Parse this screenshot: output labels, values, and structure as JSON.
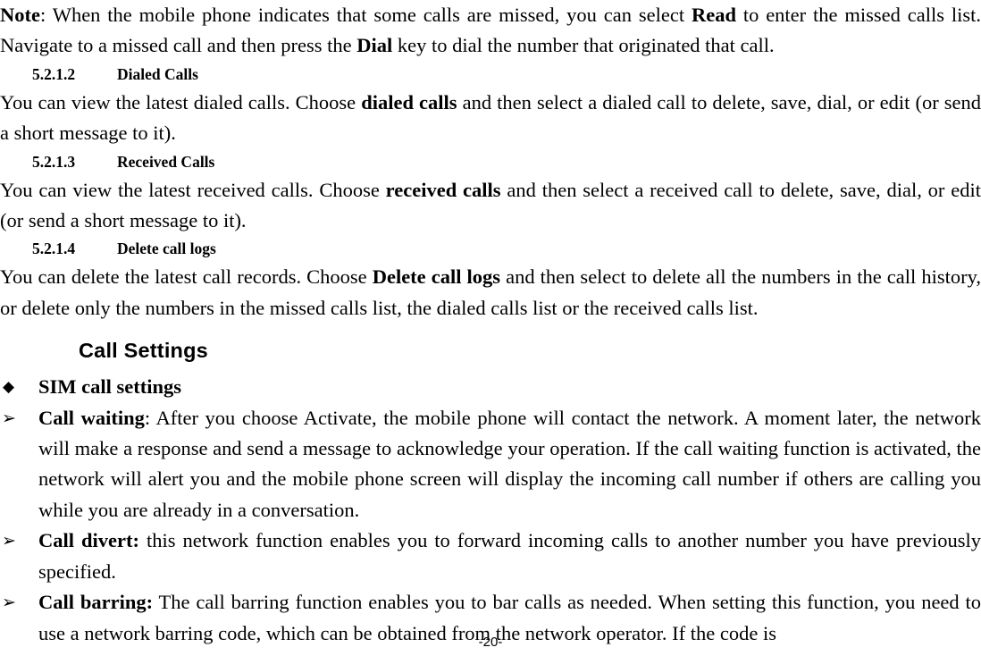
{
  "document": {
    "page_number_label": "-20-"
  },
  "blocks": {
    "note_paragraph": {
      "lead_bold": "Note",
      "text_part_1": ": When the mobile phone indicates that some calls are missed, you can select ",
      "bold_1": "Read",
      "text_part_2": " to enter the missed calls list. Navigate to a missed call and then press the ",
      "bold_2": "Dial",
      "text_part_3": " key to dial the number that originated that call."
    },
    "heading_dialed_calls": {
      "number": "5.2.1.2",
      "title": "Dialed Calls"
    },
    "paragraph_dialed_calls": {
      "text_part_1": "You can view the latest dialed calls. Choose ",
      "bold_1": "dialed calls",
      "text_part_2": " and then select a dialed call to delete, save, dial, or edit (or send a short message to it)."
    },
    "heading_received_calls": {
      "number": "5.2.1.3",
      "title": "Received Calls"
    },
    "paragraph_received_calls": {
      "text_part_1": "You can view the latest received calls. Choose ",
      "bold_1": "received calls",
      "text_part_2": " and then select a received call to delete, save, dial, or edit (or send a short message to it)."
    },
    "heading_delete_call_logs": {
      "number": "5.2.1.4",
      "title": "Delete call logs"
    },
    "paragraph_delete_call_logs": {
      "text_part_1": "You can delete the latest call records. Choose ",
      "bold_1": "Delete call logs",
      "text_part_2": " and then select to delete all the numbers in the call history, or delete only the numbers in the missed calls list, the dialed calls list or the received calls list."
    },
    "heading_call_settings": {
      "title": "Call Settings"
    },
    "bullet_sim_call_settings": {
      "marker": "◆",
      "marker_name": "diamond-bullet",
      "text": "SIM call settings"
    },
    "bullet_call_waiting": {
      "marker": "➢",
      "marker_name": "arrow-bullet",
      "bold_1": "Call waiting",
      "text_part_1": ": After you choose Activate, the mobile phone will contact the network. A moment later, the network will make a response and send a message to acknowledge your operation. If the call waiting function is activated, the network will alert you and the mobile phone screen will display the incoming call number if others are calling you while you are already in a conversation."
    },
    "bullet_call_divert": {
      "marker": "➢",
      "marker_name": "arrow-bullet",
      "bold_1": "Call divert:",
      "text_part_1": " this network function enables you to forward incoming calls to another number you have previously specified."
    },
    "bullet_call_barring": {
      "marker": "➢",
      "marker_name": "arrow-bullet",
      "bold_1": "Call barring:",
      "text_part_1": " The call barring function enables you to bar calls as needed. When setting this function, you need to use a network barring code, which can be obtained from the network operator. If the code is"
    }
  }
}
